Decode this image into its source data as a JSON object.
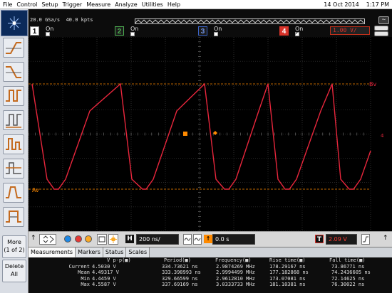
{
  "menu": [
    "File",
    "Control",
    "Setup",
    "Trigger",
    "Measure",
    "Analyze",
    "Utilities",
    "Help"
  ],
  "datetime": {
    "date": "14 Oct 2014",
    "time": "1:17 PM"
  },
  "acquisition": {
    "rate": "20.0 GSa/s",
    "points": "40.0 kpts"
  },
  "channels": [
    {
      "num": "1",
      "state": "On",
      "color": "#f2f2f2",
      "checked": false
    },
    {
      "num": "2",
      "state": "On",
      "color": "#4caf50",
      "checked": false
    },
    {
      "num": "3",
      "state": "On",
      "color": "#3b63c4",
      "checked": false
    },
    {
      "num": "4",
      "state": "On",
      "color": "#d8332a",
      "checked": true,
      "scale": "1.00 V/"
    }
  ],
  "markers": {
    "top": "Bv",
    "bottom": "Av",
    "right": "4"
  },
  "left": {
    "more_label": "More",
    "more_sub": "(1 of 2)",
    "delete_label": "Delete",
    "delete_sub": "All"
  },
  "controls": {
    "h_label": "H",
    "horizontal_scale": "200 ns/",
    "delay": "0.0 s",
    "t_label": "T",
    "trigger_level": "2.09 V"
  },
  "measurements": {
    "tabs": [
      "Measurements",
      "Markers",
      "Status",
      "Scales"
    ],
    "headers": [
      "V p-p(■)",
      "Period(■)",
      "Frequency(■)",
      "Rise time(■)",
      "Fall time(■)"
    ],
    "rows": [
      {
        "label": "Current",
        "values": [
          "4.5030 V",
          "334.73621 ns",
          "2.9874269 MHz",
          "178.29167 ns",
          "73.86771 ns"
        ]
      },
      {
        "label": "Mean",
        "values": [
          "4.49317 V",
          "333.398993 ns",
          "2.9994499 MHz",
          "177.182868 ns",
          "74.2436605 ns"
        ]
      },
      {
        "label": "Min",
        "values": [
          "4.4459 V",
          "329.66599 ns",
          "2.9612810 MHz",
          "173.07081 ns",
          "72.14625 ns"
        ]
      },
      {
        "label": "Max",
        "values": [
          "4.5587 V",
          "337.69169 ns",
          "3.0333733 MHz",
          "181.10381 ns",
          "76.30022 ns"
        ]
      }
    ]
  },
  "colors": {
    "trace": "#e8263c",
    "marker": "#ff8a00"
  }
}
